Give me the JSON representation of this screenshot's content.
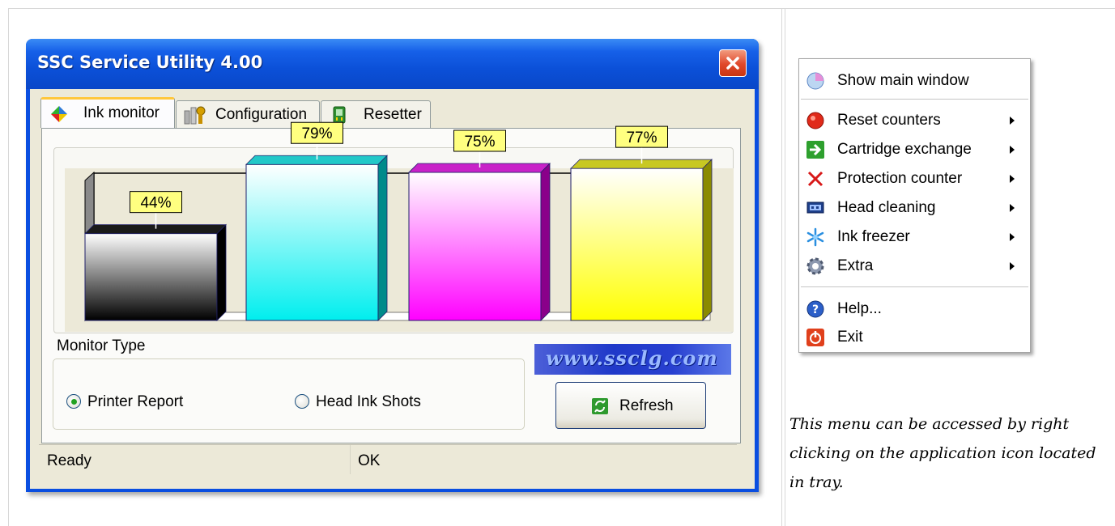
{
  "window": {
    "title": "SSC Service Utility 4.00",
    "tabs": [
      {
        "label": "Ink monitor",
        "active": true,
        "icon": "ink-drops-icon"
      },
      {
        "label": "Configuration",
        "active": false,
        "icon": "tools-icon"
      },
      {
        "label": "Resetter",
        "active": false,
        "icon": "chip-icon"
      }
    ],
    "monitor_type": {
      "label": "Monitor Type",
      "options": [
        {
          "label": "Printer Report",
          "checked": true
        },
        {
          "label": "Head Ink Shots",
          "checked": false
        }
      ]
    },
    "logo_text": "www.ssclg.com",
    "refresh_label": "Refresh",
    "status": [
      "Ready",
      "OK"
    ]
  },
  "chart_data": {
    "type": "bar",
    "categories": [
      "Black",
      "Cyan",
      "Magenta",
      "Yellow"
    ],
    "values": [
      44,
      79,
      75,
      77
    ],
    "labels": [
      "44%",
      "79%",
      "75%",
      "77%"
    ],
    "colors": [
      "#000000",
      "#00f0f0",
      "#ff00ff",
      "#ffff00"
    ],
    "ylim": [
      0,
      100
    ],
    "title": "",
    "xlabel": "",
    "ylabel": ""
  },
  "context_menu": {
    "items": [
      {
        "label": "Show main window",
        "icon": "window-icon",
        "submenu": false
      },
      {
        "separator": true
      },
      {
        "label": "Reset counters",
        "icon": "red-circle-icon",
        "submenu": true
      },
      {
        "label": "Cartridge exchange",
        "icon": "green-arrow-icon",
        "submenu": true
      },
      {
        "label": "Protection counter",
        "icon": "red-x-icon",
        "submenu": true
      },
      {
        "label": "Head cleaning",
        "icon": "print-head-icon",
        "submenu": true
      },
      {
        "label": "Ink freezer",
        "icon": "snowflake-icon",
        "submenu": true
      },
      {
        "label": "Extra",
        "icon": "gear-icon",
        "submenu": true
      },
      {
        "separator": true
      },
      {
        "label": "Help...",
        "icon": "help-icon",
        "submenu": false
      },
      {
        "label": "Exit",
        "icon": "power-icon",
        "submenu": false
      }
    ]
  },
  "note": "This menu can be accessed by right clicking on the application icon located in tray."
}
